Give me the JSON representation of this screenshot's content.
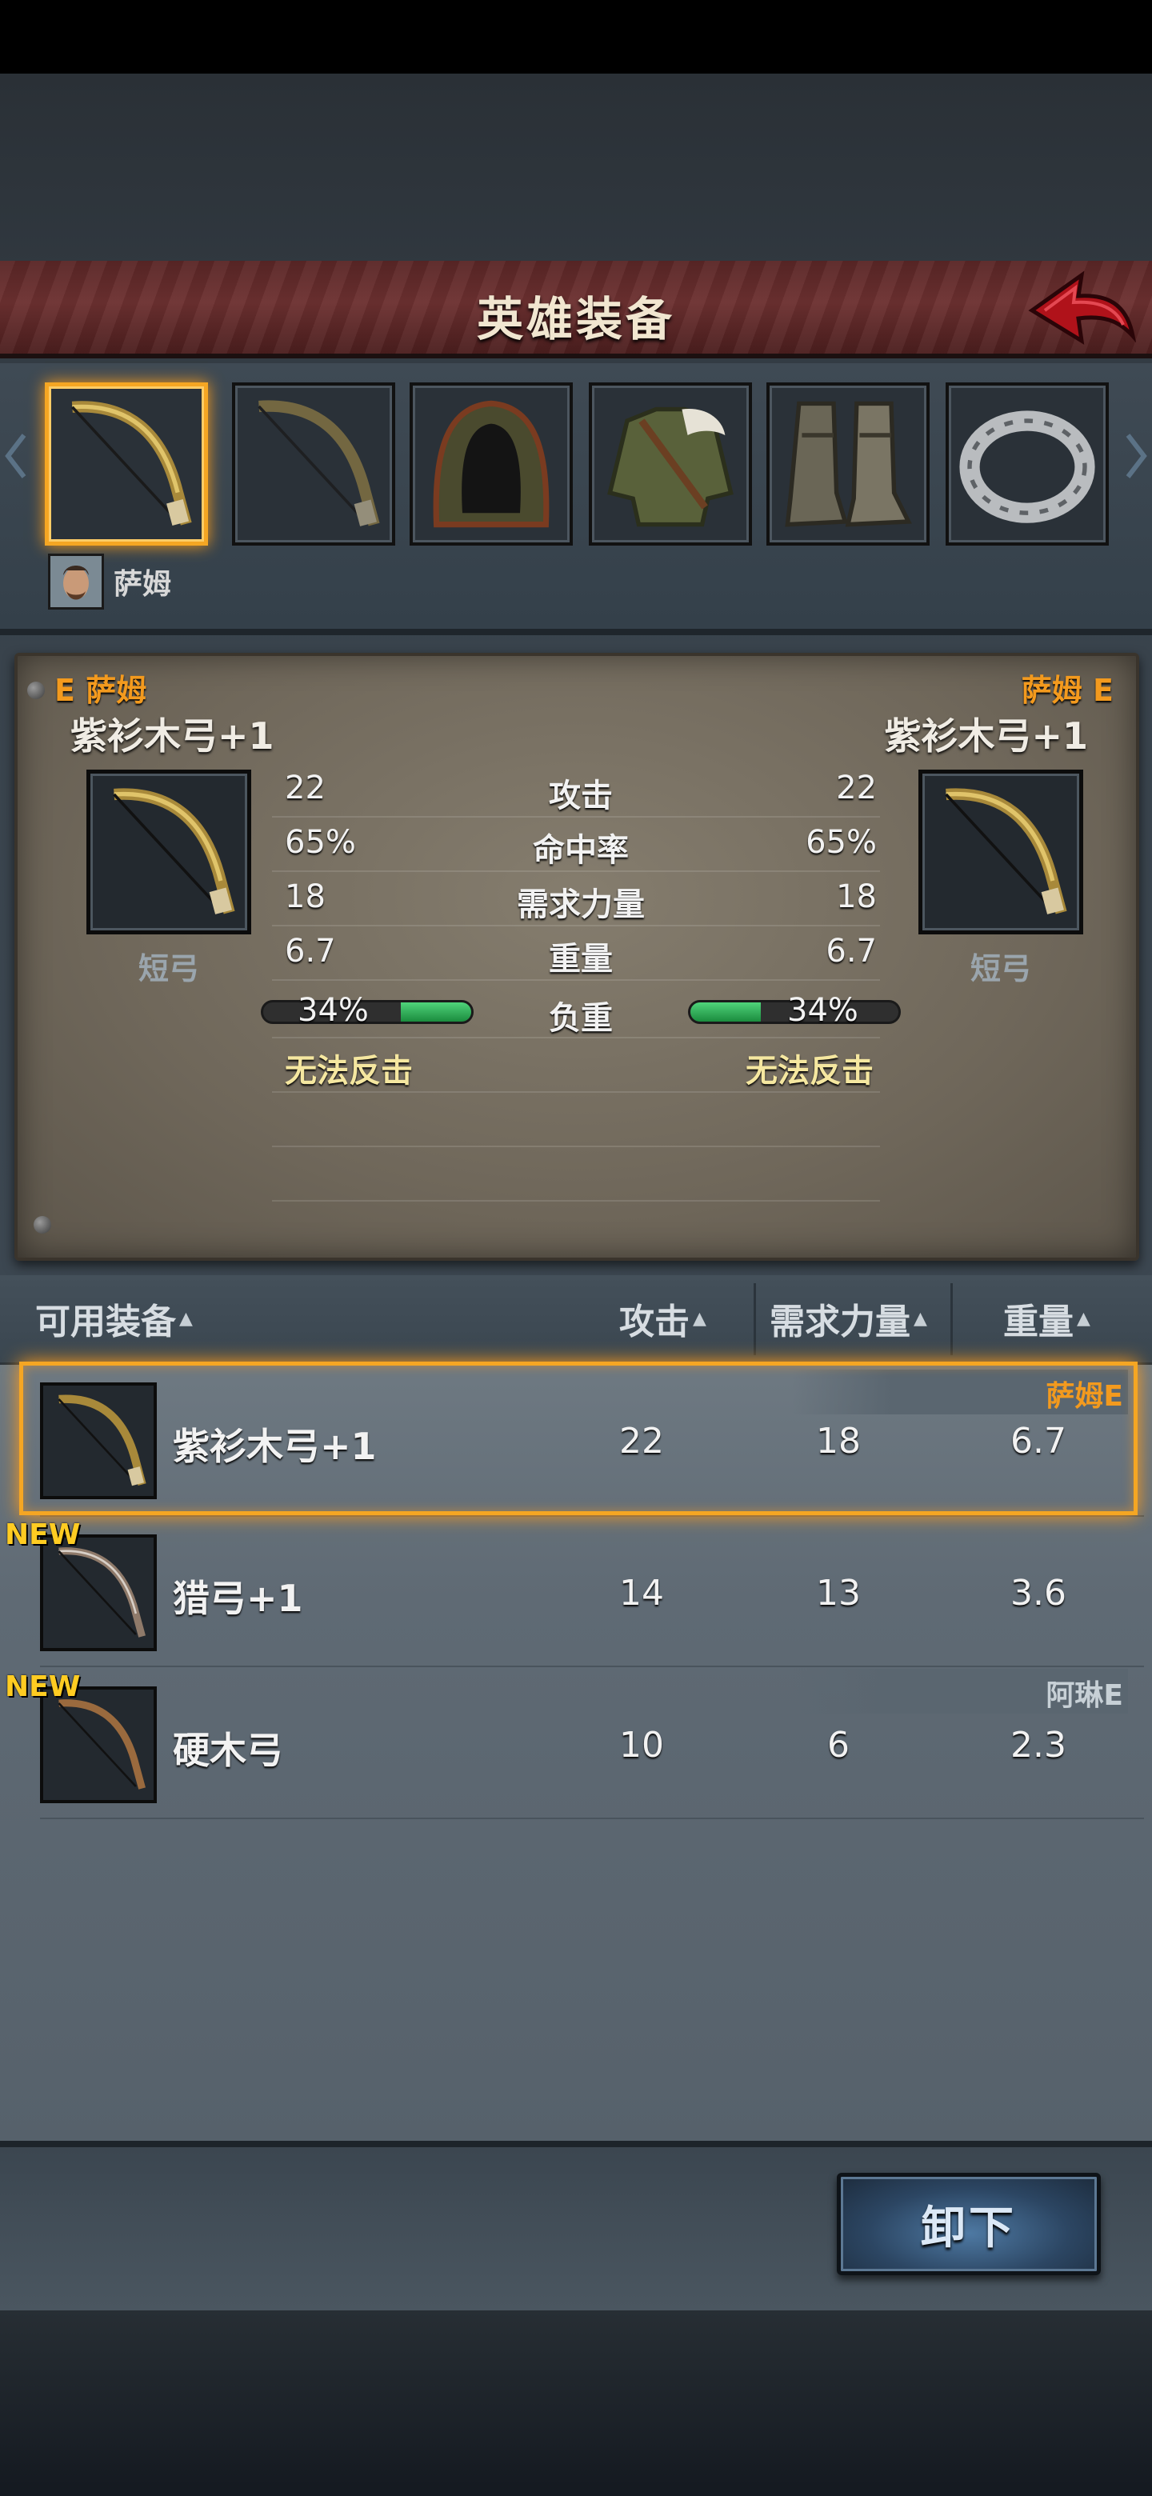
{
  "header": {
    "title": "英雄装备"
  },
  "hero": {
    "name": "萨姆"
  },
  "slots": [
    {
      "item": "bow",
      "selected": true
    },
    {
      "item": "bow",
      "selected": false
    },
    {
      "item": "hood",
      "selected": false
    },
    {
      "item": "tunic",
      "selected": false
    },
    {
      "item": "boots",
      "selected": false
    },
    {
      "item": "ring",
      "selected": false
    }
  ],
  "compare": {
    "left": {
      "equip_tag": "E 萨姆",
      "name": "紫衫木弓+1",
      "type": "短弓",
      "attack": "22",
      "accuracy": "65%",
      "strength_req": "18",
      "weight": "6.7",
      "load": "34%",
      "load_fraction": 0.34,
      "counter": "无法反击"
    },
    "right": {
      "equip_tag": "萨姆 E",
      "name": "紫衫木弓+1",
      "type": "短弓",
      "attack": "22",
      "accuracy": "65%",
      "strength_req": "18",
      "weight": "6.7",
      "load": "34%",
      "load_fraction": 0.34,
      "counter": "无法反击"
    },
    "labels": {
      "attack": "攻击",
      "accuracy": "命中率",
      "strength_req": "需求力量",
      "weight": "重量",
      "load": "负重"
    }
  },
  "list": {
    "columns": {
      "name": "可用装备",
      "attack": "攻击",
      "strength_req": "需求力量",
      "weight": "重量"
    },
    "sort_indicator": "▲",
    "rows": [
      {
        "name": "紫衫木弓+1",
        "attack": "22",
        "strength_req": "18",
        "weight": "6.7",
        "owner": "萨姆E",
        "new": "",
        "selected": true
      },
      {
        "name": "猎弓+1",
        "attack": "14",
        "strength_req": "13",
        "weight": "3.6",
        "owner": "",
        "new": "NEW",
        "selected": false
      },
      {
        "name": "硬木弓",
        "attack": "10",
        "strength_req": "6",
        "weight": "2.3",
        "owner": "阿琳E",
        "new": "NEW",
        "selected": false
      }
    ]
  },
  "actions": {
    "unequip": "卸下"
  },
  "colors": {
    "accent_orange": "#f5a623",
    "owner_tag": "#f39a1e",
    "load_green": "#2fa857",
    "button_blue": "#2c4663"
  }
}
